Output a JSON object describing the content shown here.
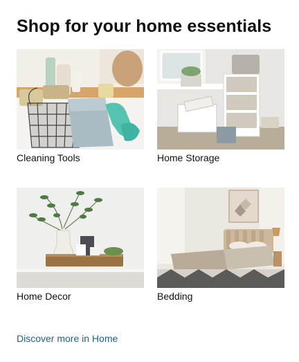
{
  "card": {
    "title": "Shop for your home essentials",
    "tiles": [
      {
        "label": "Cleaning Tools",
        "image": "cleaning-tools-photo"
      },
      {
        "label": "Home Storage",
        "image": "home-storage-photo"
      },
      {
        "label": "Home Decor",
        "image": "home-decor-photo"
      },
      {
        "label": "Bedding",
        "image": "bedding-photo"
      }
    ],
    "link": "Discover more in Home"
  },
  "colors": {
    "title": "#0f1111",
    "link": "#1a6193",
    "background": "#ffffff"
  }
}
